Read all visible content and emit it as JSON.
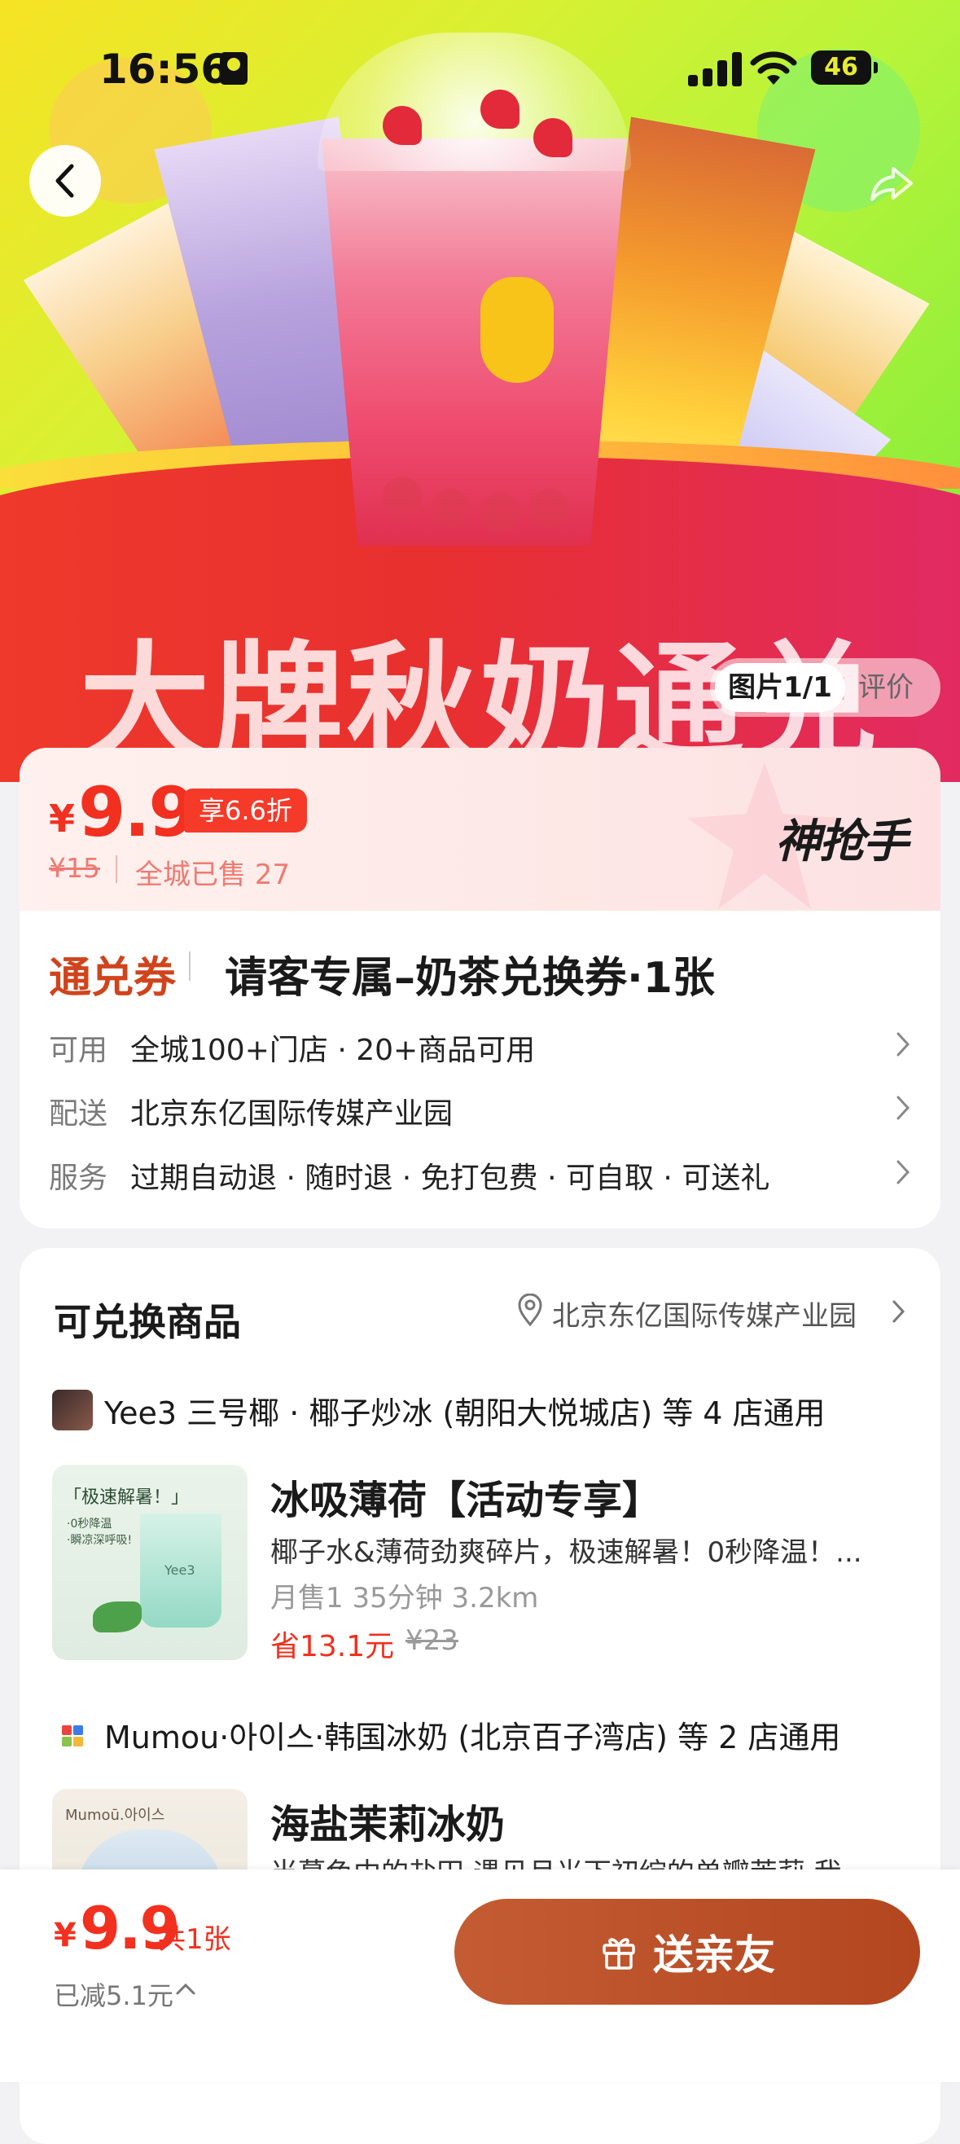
{
  "status_bar": {
    "time": "16:56",
    "battery": "46"
  },
  "hero": {
    "banner_text": "大牌秋奶通兑"
  },
  "image_tabs": {
    "active": "图片1/1",
    "review": "评价"
  },
  "price": {
    "currency": "¥",
    "value": "9.9",
    "discount": "享6.6折",
    "original": "¥15",
    "sold": "全城已售 27",
    "brand": "神抢手"
  },
  "voucher": {
    "tag": "通兑券",
    "title": "请客专属–奶茶兑换券·1张"
  },
  "info_rows": [
    {
      "label": "可用",
      "value": "全城100+门店 · 20+商品可用"
    },
    {
      "label": "配送",
      "value": "北京东亿国际传媒产业园"
    },
    {
      "label": "服务",
      "value": "过期自动退 · 随时退 · 免打包费 · 可自取 · 可送礼"
    }
  ],
  "exchange": {
    "title": "可兑换商品",
    "location": "北京东亿国际传媒产业园",
    "stores": [
      {
        "name": "Yee3 三号椰 · 椰子炒冰 (朝阳大悦城店) 等 4 店通用",
        "product": {
          "name": "冰吸薄荷【活动专享】",
          "desc": "椰子水&薄荷劲爽碎片，极速解暑！0秒降温！...",
          "meta": "月售1  35分钟 3.2km",
          "save": "省13.1元",
          "original": "¥23",
          "img_caption": "「极速解暑！」",
          "img_sub1": "·0秒降温",
          "img_sub2": "·瞬凉深呼吸!",
          "img_brand": "Yee3"
        }
      },
      {
        "name": "Mumou·아이스·韩国冰奶 (北京百子湾店) 等 2 店通用",
        "product": {
          "name": "海盐茉莉冰奶",
          "desc": "当暮色中的盐田 遇见月光下初绽的单瓣茉莉 我",
          "img_brand": "Mumoū.아이스"
        }
      }
    ]
  },
  "bottom_bar": {
    "currency": "¥",
    "price": "9.9",
    "count": "共1张",
    "reduced": "已减5.1元",
    "gift_label": "送亲友"
  },
  "colors": {
    "accent_red": "#f2301f",
    "voucher_tag": "#d0441c",
    "gift_button": "#b3461f"
  }
}
